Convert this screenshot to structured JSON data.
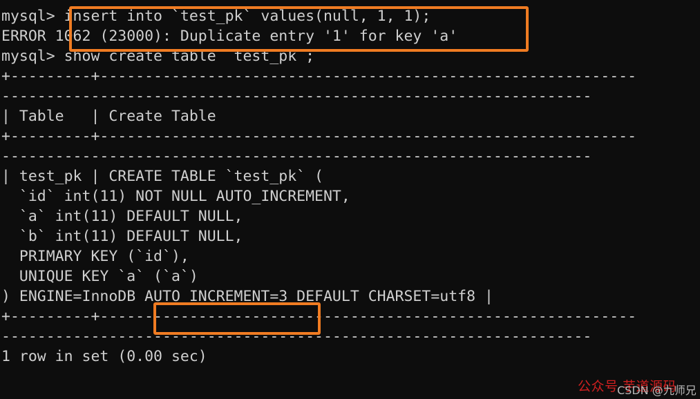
{
  "terminal": {
    "background_color": "#0d0d0d",
    "text_color": "#cfcfcf",
    "highlight_color": "#f07c22",
    "prompt": "mysql>",
    "lines": [
      "mysql> insert into `test_pk` values(null, 1, 1);",
      "ERROR 1062 (23000): Duplicate entry '1' for key 'a'",
      "mysql> show create table `test_pk`;",
      "+----------+---------------------------------------------------------------------------------------------------------------+",
      "| Table    | Create Table                                                                                                  |",
      "+----------+---------------------------------------------------------------------------------------------------------------+",
      "| test_pk | CREATE TABLE `test_pk` (",
      "  `id` int(11) NOT NULL AUTO_INCREMENT,",
      "  `a` int(11) DEFAULT NULL,",
      "  `b` int(11) DEFAULT NULL,",
      "  PRIMARY KEY (`id`),",
      "  UNIQUE KEY `a` (`a`)",
      ") ENGINE=InnoDB AUTO_INCREMENT=3 DEFAULT CHARSET=utf8 |",
      "+----------+---------------------------------------------------------------------------------------------------------------+",
      "1 row in set (0.00 sec)"
    ],
    "rendered_rows": {
      "r1": "mysql> insert into `test_pk` values(null, 1, 1);",
      "r2": "ERROR 1062 (23000): Duplicate entry '1' for key 'a'",
      "r3": "mysql> show create table `test_pk`;",
      "r4a": "+---------+------------------------------------------------------------",
      "r4b": "------------------------------------------------------------------",
      "r5": "| Table   | Create Table",
      "r6a": "+---------+------------------------------------------------------------",
      "r6b": "------------------------------------------------------------------",
      "r7": "| test_pk | CREATE TABLE `test_pk` (",
      "r8": "  `id` int(11) NOT NULL AUTO_INCREMENT,",
      "r9": "  `a` int(11) DEFAULT NULL,",
      "r10": "  `b` int(11) DEFAULT NULL,",
      "r11": "  PRIMARY KEY (`id`),",
      "r12": "  UNIQUE KEY `a` (`a`)",
      "r13": ") ENGINE=InnoDB AUTO_INCREMENT=3 DEFAULT CHARSET=utf8 |",
      "r14a": "+---------+------------------------------------------------------------",
      "r14b": "------------------------------------------------------------------",
      "r15": "1 row in set (0.00 sec)"
    },
    "highlights": [
      {
        "name": "insert-error-highlight",
        "covers": "insert into `test_pk` values(null, 1, 1); / ERROR 1062 (23000): Duplicate entry '1' for key 'a'"
      },
      {
        "name": "auto-increment-highlight",
        "covers": "AUTO_INCREMENT=3"
      }
    ]
  },
  "watermarks": {
    "red_text": "公众号 芋道源码",
    "gray_text": "CSDN @九师兄",
    "red_color": "#d02020",
    "gray_color": "#b9b9b9"
  }
}
